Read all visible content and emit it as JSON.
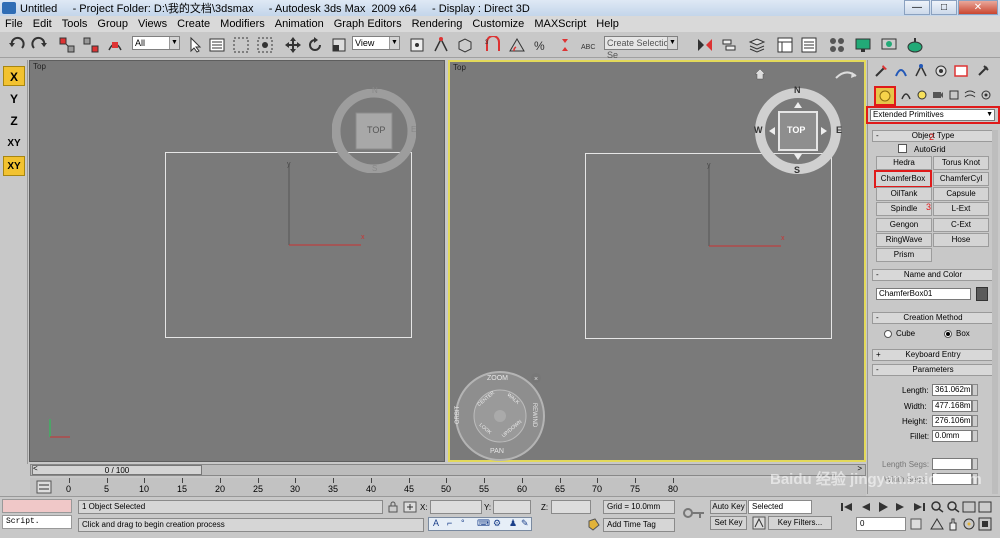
{
  "titlebar": {
    "title": "Untitled     - Project Folder: D:\\我的文档\\3dsmax     - Autodesk 3ds Max  2009 x64     - Display : Direct 3D"
  },
  "menubar": {
    "items": [
      "File",
      "Edit",
      "Tools",
      "Group",
      "Views",
      "Create",
      "Modifiers",
      "Animation",
      "Graph Editors",
      "Rendering",
      "Customize",
      "MAXScript",
      "Help"
    ]
  },
  "toolbar": {
    "selection_filter": "All",
    "reference_coord": "View",
    "named_selection_placeholder": "Create Selection Se"
  },
  "axisbar": {
    "buttons": [
      "X",
      "Y",
      "Z",
      "XY",
      "XY"
    ]
  },
  "viewports": {
    "left_label": "Top",
    "right_label": "Top",
    "viewcube_label": "TOP",
    "compass": {
      "n": "N",
      "s": "S",
      "e": "E",
      "w": "W"
    },
    "steering_wheel": {
      "zoom": "ZOOM",
      "pan": "PAN",
      "orbit": "ORBIT",
      "rewind": "REWIND",
      "center": "CENTER",
      "walk": "WALK",
      "look": "LOOK",
      "updown": "UP/DOWN"
    },
    "axis_x": "x",
    "axis_y": "y"
  },
  "panel": {
    "category_dropdown": "Extended Primitives",
    "object_type_title": "Object Type",
    "autogrid_label": "AutoGrid",
    "object_buttons": [
      [
        "Hedra",
        "Torus Knot"
      ],
      [
        "ChamferBox",
        "ChamferCyl"
      ],
      [
        "OilTank",
        "Capsule"
      ],
      [
        "Spindle",
        "L-Ext"
      ],
      [
        "Gengon",
        "C-Ext"
      ],
      [
        "RingWave",
        "Hose"
      ],
      [
        "Prism",
        ""
      ]
    ],
    "annotation_2": "2",
    "annotation_3": "3",
    "name_color_title": "Name and Color",
    "object_name": "ChamferBox01",
    "object_color": "#5a5a5a",
    "creation_method_title": "Creation Method",
    "creation_cube": "Cube",
    "creation_box": "Box",
    "keyboard_entry_title": "Keyboard Entry",
    "parameters_title": "Parameters",
    "length_label": "Length:",
    "length_value": "361.062m",
    "width_label": "Width:",
    "width_value": "477.168m",
    "height_label": "Height:",
    "height_value": "276.106m",
    "fillet_label": "Fillet:",
    "fillet_value": "0.0mm",
    "length_segs_label": "Length Segs:",
    "width_segs_label": "Width Segs:"
  },
  "timeline": {
    "slider_label": "0 / 100",
    "ticks": [
      "0",
      "5",
      "10",
      "15",
      "20",
      "25",
      "30",
      "35",
      "40",
      "45",
      "50",
      "55",
      "60",
      "65",
      "70",
      "75",
      "80"
    ]
  },
  "statusbar": {
    "script_label": "Script.",
    "selection_status": "1 Object Selected",
    "prompt": "Click and drag to begin creation process",
    "x_label": "X:",
    "y_label": "Y:",
    "z_label": "Z:",
    "grid": "Grid = 10.0mm",
    "add_time_tag": "Add Time Tag",
    "auto_key": "Auto Key",
    "auto_key_mode": "Selected",
    "set_key": "Set Key",
    "key_filters": "Key Filters...",
    "frame": "0"
  },
  "watermark": "Baidu 经验 jingyan.baidu.com",
  "colors": {
    "viewport_bg": "#7a7a7a",
    "active_viewport_border": "#e3d95a",
    "highlight_red": "#e01a1a",
    "axis_active": "#f2c230"
  }
}
